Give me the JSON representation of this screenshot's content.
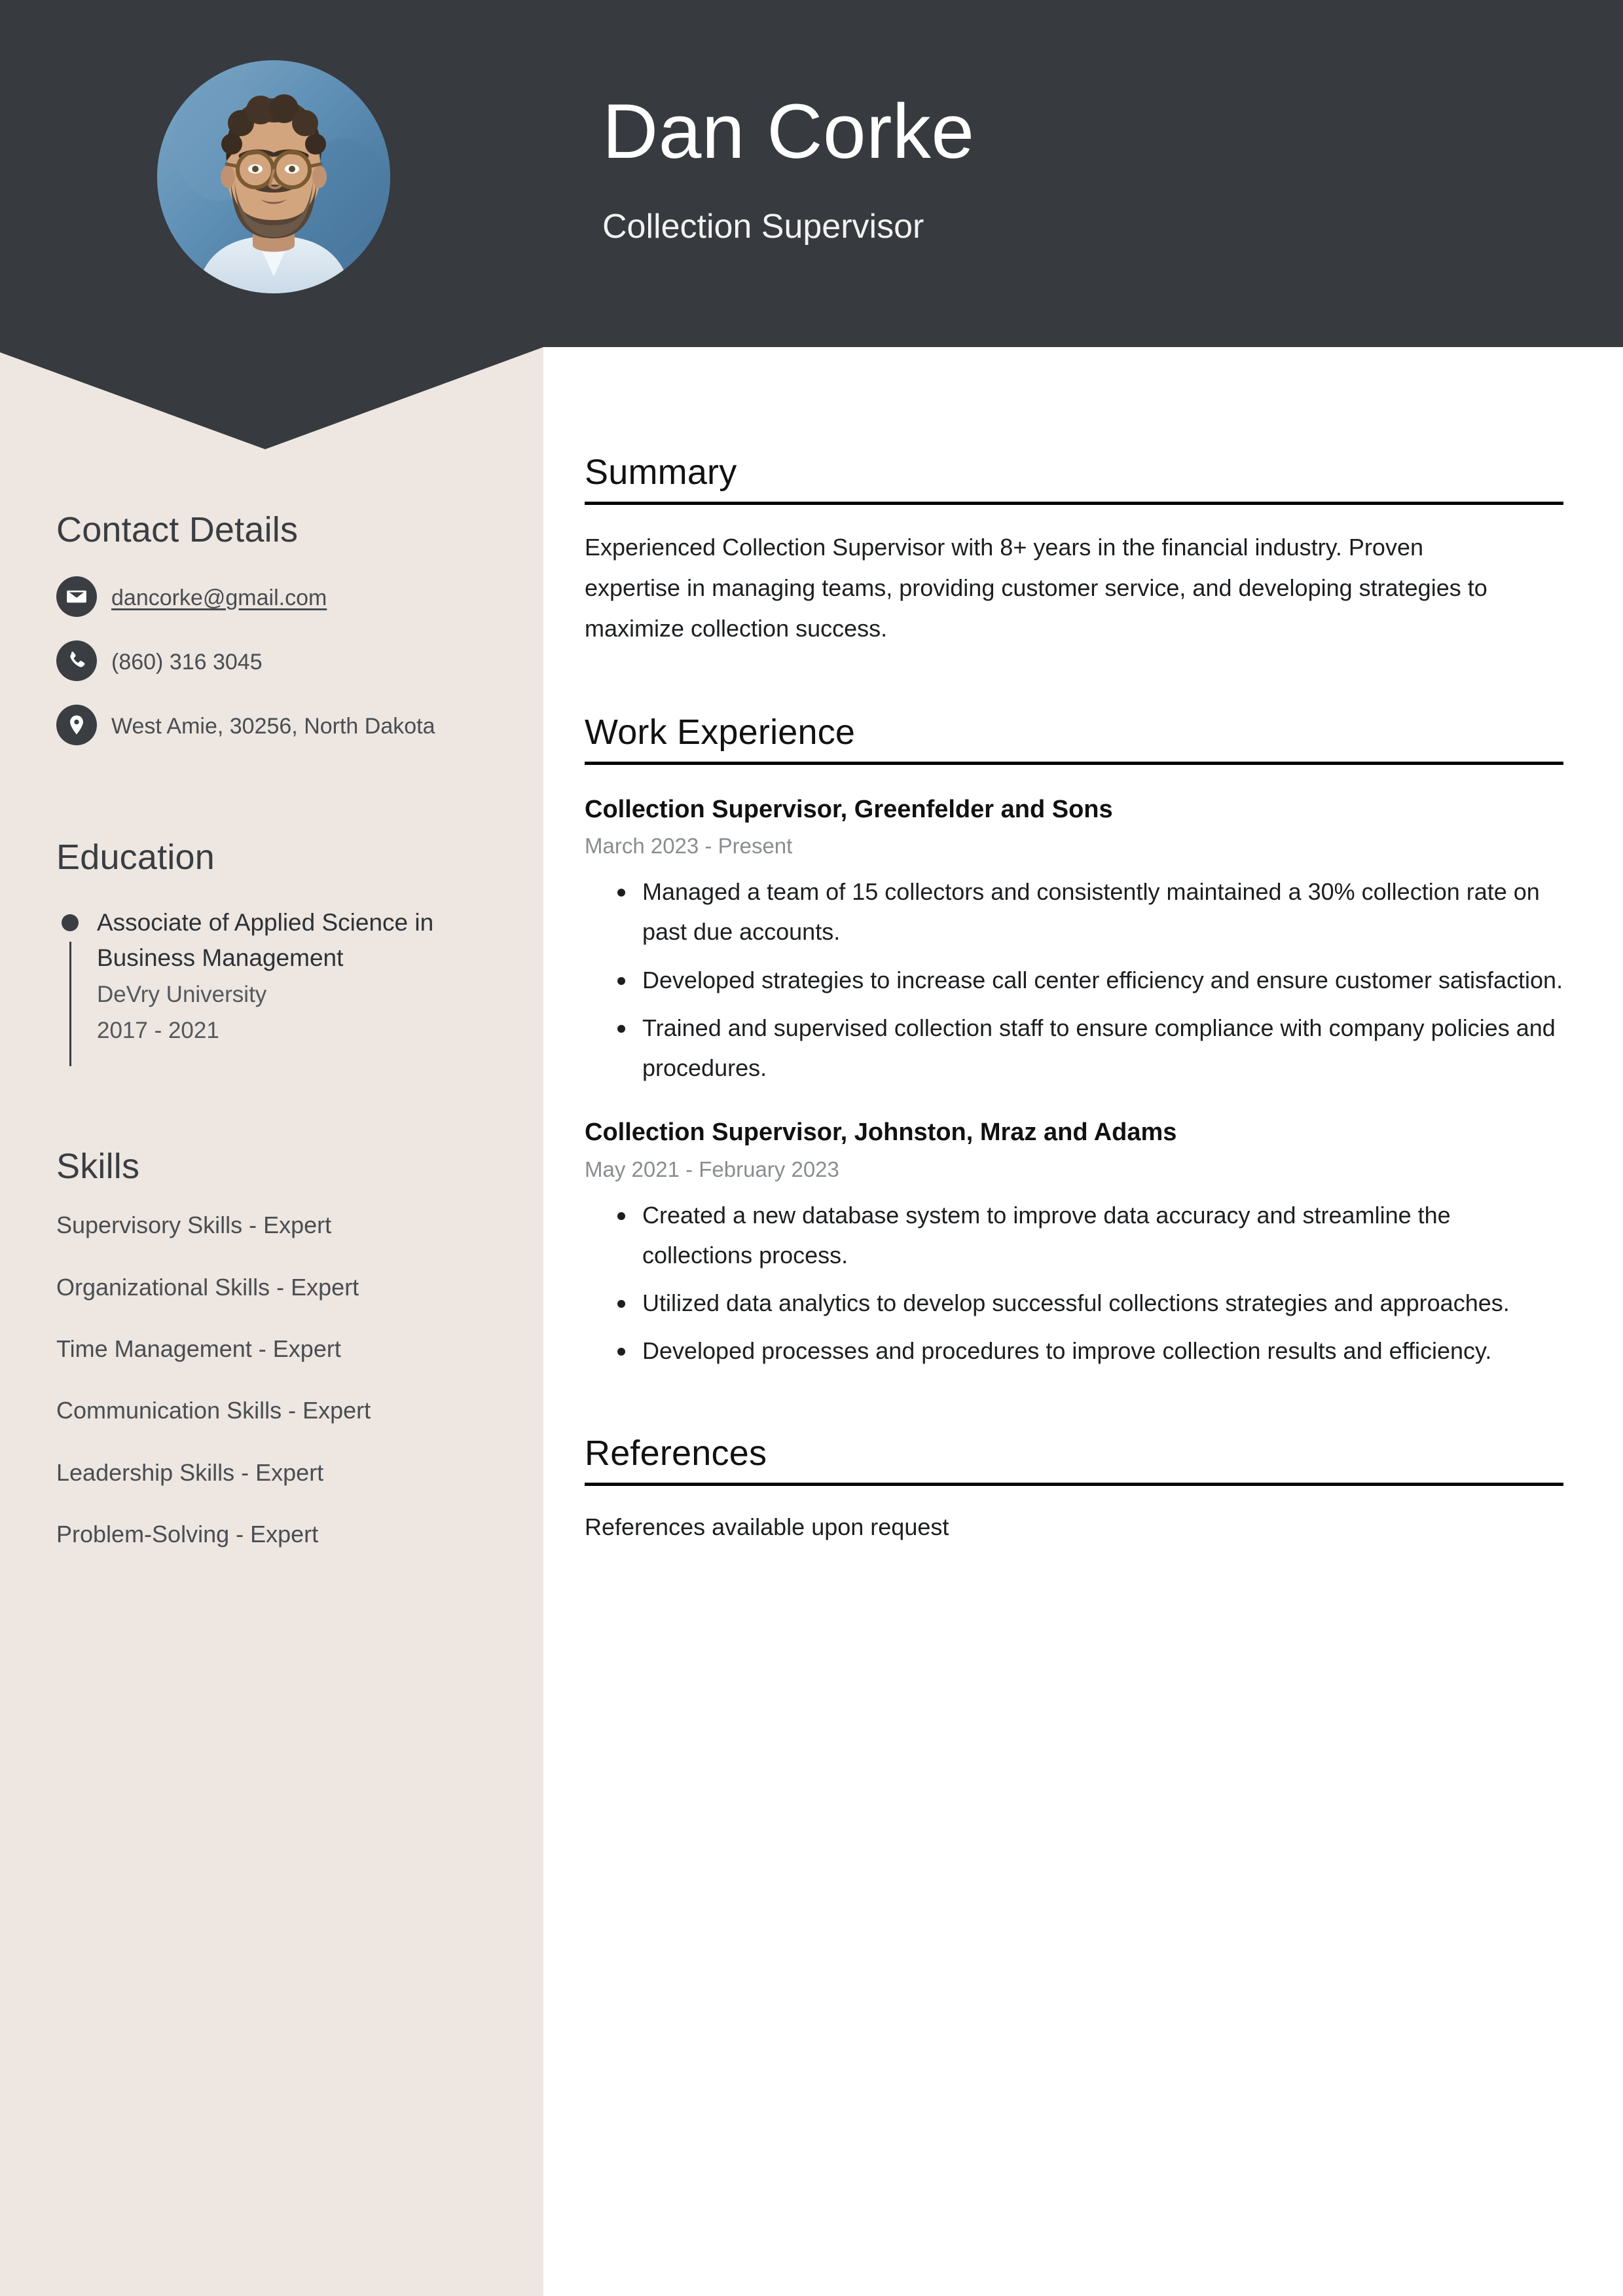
{
  "colors": {
    "header_dark": "#373A3E",
    "sidebar_beige": "#EDE6E1",
    "main_white": "#FFFFFF",
    "text_dark": "#1C1E20",
    "muted_gray": "#8A8D90"
  },
  "header": {
    "name": "Dan Corke",
    "job_title": "Collection Supervisor",
    "avatar_alt": "portrait-photo"
  },
  "sidebar": {
    "contact": {
      "heading": "Contact Details",
      "items": [
        {
          "icon": "envelope-icon",
          "value": "dancorke@gmail.com",
          "is_link": true
        },
        {
          "icon": "phone-icon",
          "value": "(860) 316 3045",
          "is_link": false
        },
        {
          "icon": "location-pin-icon",
          "value": "West Amie, 30256, North Dakota",
          "is_link": false
        }
      ]
    },
    "education": {
      "heading": "Education",
      "entries": [
        {
          "degree": "Associate of Applied Science in Business Management",
          "school": "DeVry University",
          "dates": "2017 - 2021"
        }
      ]
    },
    "skills": {
      "heading": "Skills",
      "items": [
        "Supervisory Skills - Expert",
        "Organizational Skills - Expert",
        "Time Management - Expert",
        "Communication Skills - Expert",
        "Leadership Skills - Expert",
        "Problem-Solving - Expert"
      ]
    }
  },
  "main": {
    "summary": {
      "heading": "Summary",
      "text": "Experienced Collection Supervisor with 8+ years in the financial industry. Proven expertise in managing teams, providing customer service, and developing strategies to maximize collection success."
    },
    "work_experience": {
      "heading": "Work Experience",
      "jobs": [
        {
          "role": "Collection Supervisor, Greenfelder and Sons",
          "dates": "March 2023 - Present",
          "bullets": [
            "Managed a team of 15 collectors and consistently maintained a 30% collection rate on past due accounts.",
            "Developed strategies to increase call center efficiency and ensure customer satisfaction.",
            "Trained and supervised collection staff to ensure compliance with company policies and procedures."
          ]
        },
        {
          "role": "Collection Supervisor, Johnston, Mraz and Adams",
          "dates": "May 2021 - February 2023",
          "bullets": [
            "Created a new database system to improve data accuracy and streamline the collections process.",
            "Utilized data analytics to develop successful collections strategies and approaches.",
            "Developed processes and procedures to improve collection results and efficiency."
          ]
        }
      ]
    },
    "references": {
      "heading": "References",
      "text": "References available upon request"
    }
  }
}
